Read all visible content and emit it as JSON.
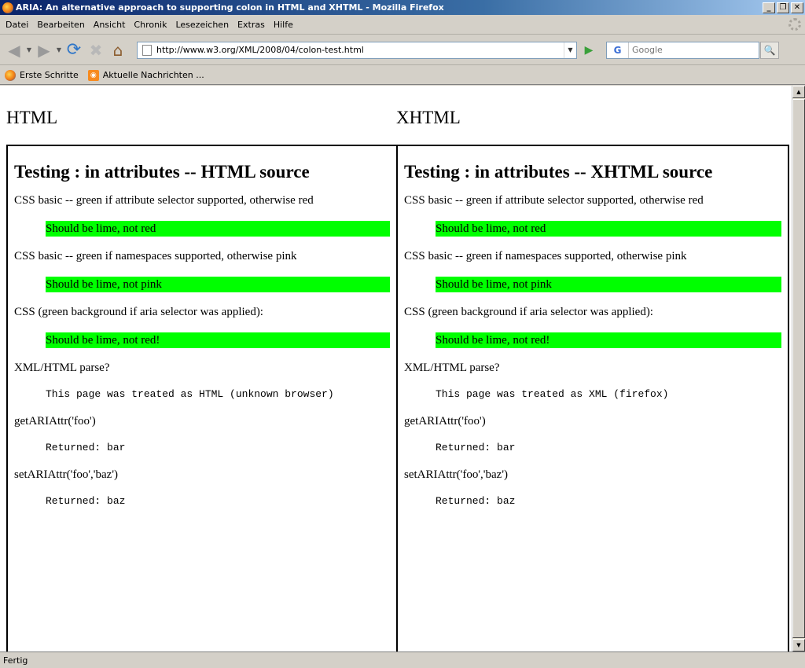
{
  "window": {
    "title": "ARIA: An alternative approach to supporting colon in HTML and XHTML - Mozilla Firefox",
    "minimize": "_",
    "restore": "❐",
    "close": "✕"
  },
  "menu": [
    "Datei",
    "Bearbeiten",
    "Ansicht",
    "Chronik",
    "Lesezeichen",
    "Extras",
    "Hilfe"
  ],
  "nav": {
    "back": "◀",
    "forward": "▶",
    "dropdown": "▼",
    "reload": "⟳",
    "stop": "✖",
    "home": "⌂",
    "url": "http://www.w3.org/XML/2008/04/colon-test.html",
    "go": "▶",
    "search_engine": "G",
    "search_placeholder": "Google",
    "search_button": "🔍"
  },
  "bookmarks": [
    {
      "label": "Erste Schritte",
      "icon": "firefox-icon"
    },
    {
      "label": "Aktuelle Nachrichten ...",
      "icon": "rss-icon"
    }
  ],
  "page": {
    "html_heading": "HTML",
    "xhtml_heading": "XHTML",
    "left": {
      "title": "Testing : in attributes -- HTML source",
      "t1_label": "CSS basic -- green if attribute selector supported, otherwise red",
      "t1_result": "Should be lime, not red",
      "t2_label": "CSS basic -- green if namespaces supported, otherwise pink",
      "t2_result": "Should be lime, not pink",
      "t3_label": "CSS (green background if aria selector was applied):",
      "t3_result": "Should be lime, not red!",
      "t4_label": "XML/HTML parse?",
      "t4_result": "This page was treated as HTML (unknown browser)",
      "t5_label": "getARIAttr('foo')",
      "t5_result": "Returned: bar",
      "t6_label": "setARIAttr('foo','baz')",
      "t6_result": "Returned: baz"
    },
    "right": {
      "title": "Testing : in attributes -- XHTML source",
      "t1_label": "CSS basic -- green if attribute selector supported, otherwise red",
      "t1_result": "Should be lime, not red",
      "t2_label": "CSS basic -- green if namespaces supported, otherwise pink",
      "t2_result": "Should be lime, not pink",
      "t3_label": "CSS (green background if aria selector was applied):",
      "t3_result": "Should be lime, not red!",
      "t4_label": "XML/HTML parse?",
      "t4_result": "This page was treated as XML (firefox)",
      "t5_label": "getARIAttr('foo')",
      "t5_result": "Returned: bar",
      "t6_label": "setARIAttr('foo','baz')",
      "t6_result": "Returned: baz"
    }
  },
  "status": "Fertig",
  "colors": {
    "lime": "#00ff00",
    "titlebar": "#0a246a"
  }
}
